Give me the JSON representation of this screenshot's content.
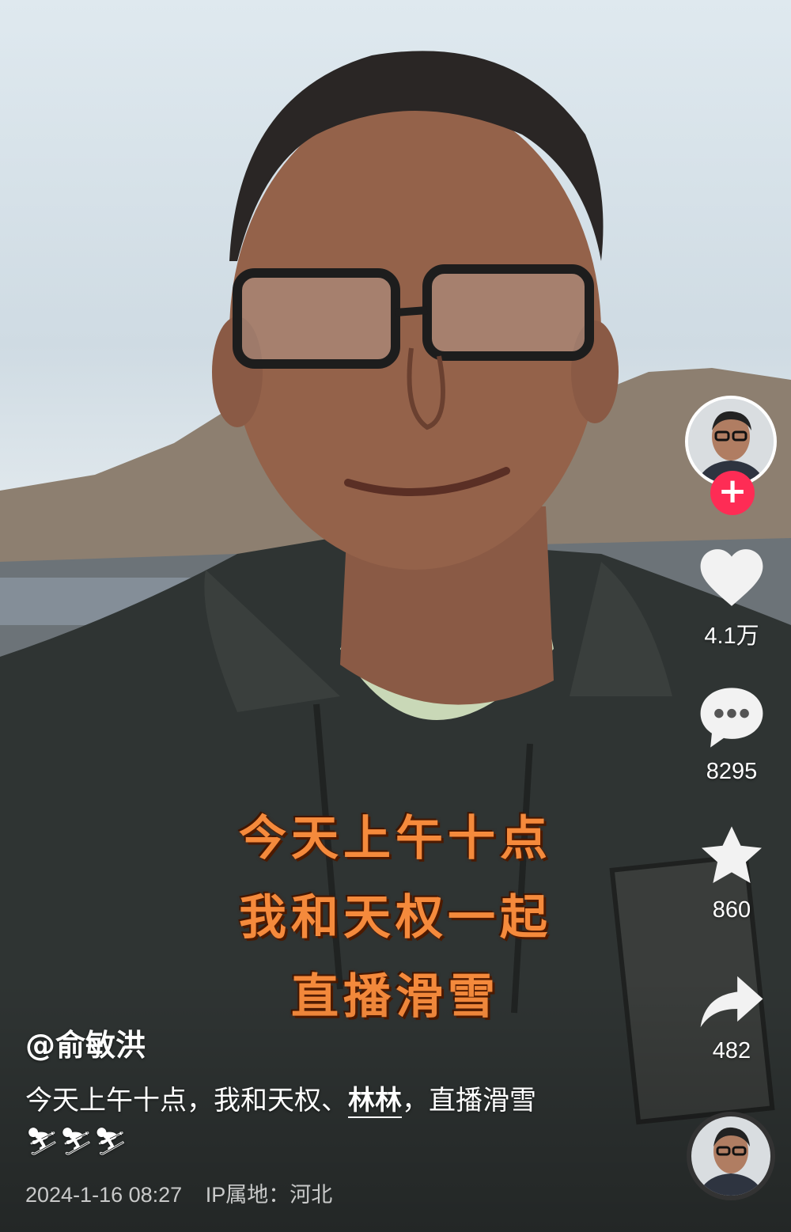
{
  "video": {
    "overlay_lines": [
      "今天上午十点",
      "我和天权一起",
      "直播滑雪"
    ]
  },
  "sidebar": {
    "likes": "4.1万",
    "comments": "8295",
    "favorites": "860",
    "shares": "482"
  },
  "post": {
    "author": "@俞敏洪",
    "desc_prefix": "今天上午十点，我和天权、",
    "mention": "林林",
    "desc_suffix": "，直播滑雪",
    "emojis": "⛷⛷⛷",
    "date": "2024-1-16 08:27",
    "location": "IP属地：河北"
  },
  "colors": {
    "follow": "#fe2c55",
    "caption": "#f58a3c"
  }
}
